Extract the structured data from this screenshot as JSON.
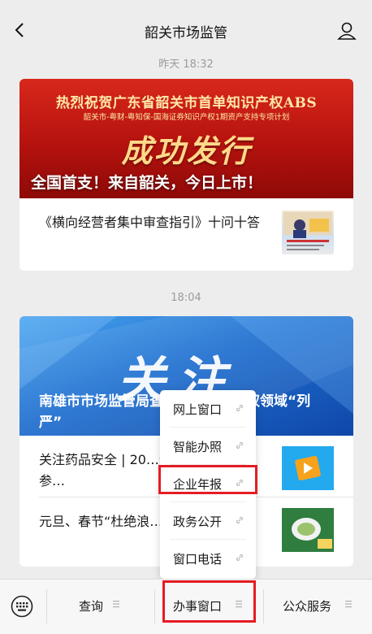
{
  "header": {
    "title": "韶关市场监管"
  },
  "timestamps": {
    "first": "昨天 18:32",
    "second": "18:04"
  },
  "article1": {
    "banner_line1": "热烈祝贺广东省韶关市首单知识产权ABS",
    "banner_line2": "韶关市-粤财-粤知保-国海证券知识产权1期资产支持专项计划",
    "banner_line3": "成功发行",
    "banner_caption": "全国首支！来自韶关，今日上市！",
    "sub_item": "《横向经营者集中审查指引》十问十答"
  },
  "article2": {
    "banner_big": "关注",
    "banner_caption": "南雄市市场监管局查处首例知识产权领域“列严”",
    "sub_item1": "关注药品安全 | 20…普创作大赛韶关参…",
    "sub_item2": "元旦、春节“杜绝浪…示"
  },
  "popup": {
    "items": [
      "网上窗口",
      "智能办照",
      "企业年报",
      "政务公开",
      "窗口电话"
    ]
  },
  "bottom_menu": {
    "tabs": [
      "查询",
      "办事窗口",
      "公众服务"
    ]
  },
  "colors": {
    "highlight": "#e51c23",
    "banner_red": "#c41a14",
    "banner_blue": "#1f6fd0"
  }
}
